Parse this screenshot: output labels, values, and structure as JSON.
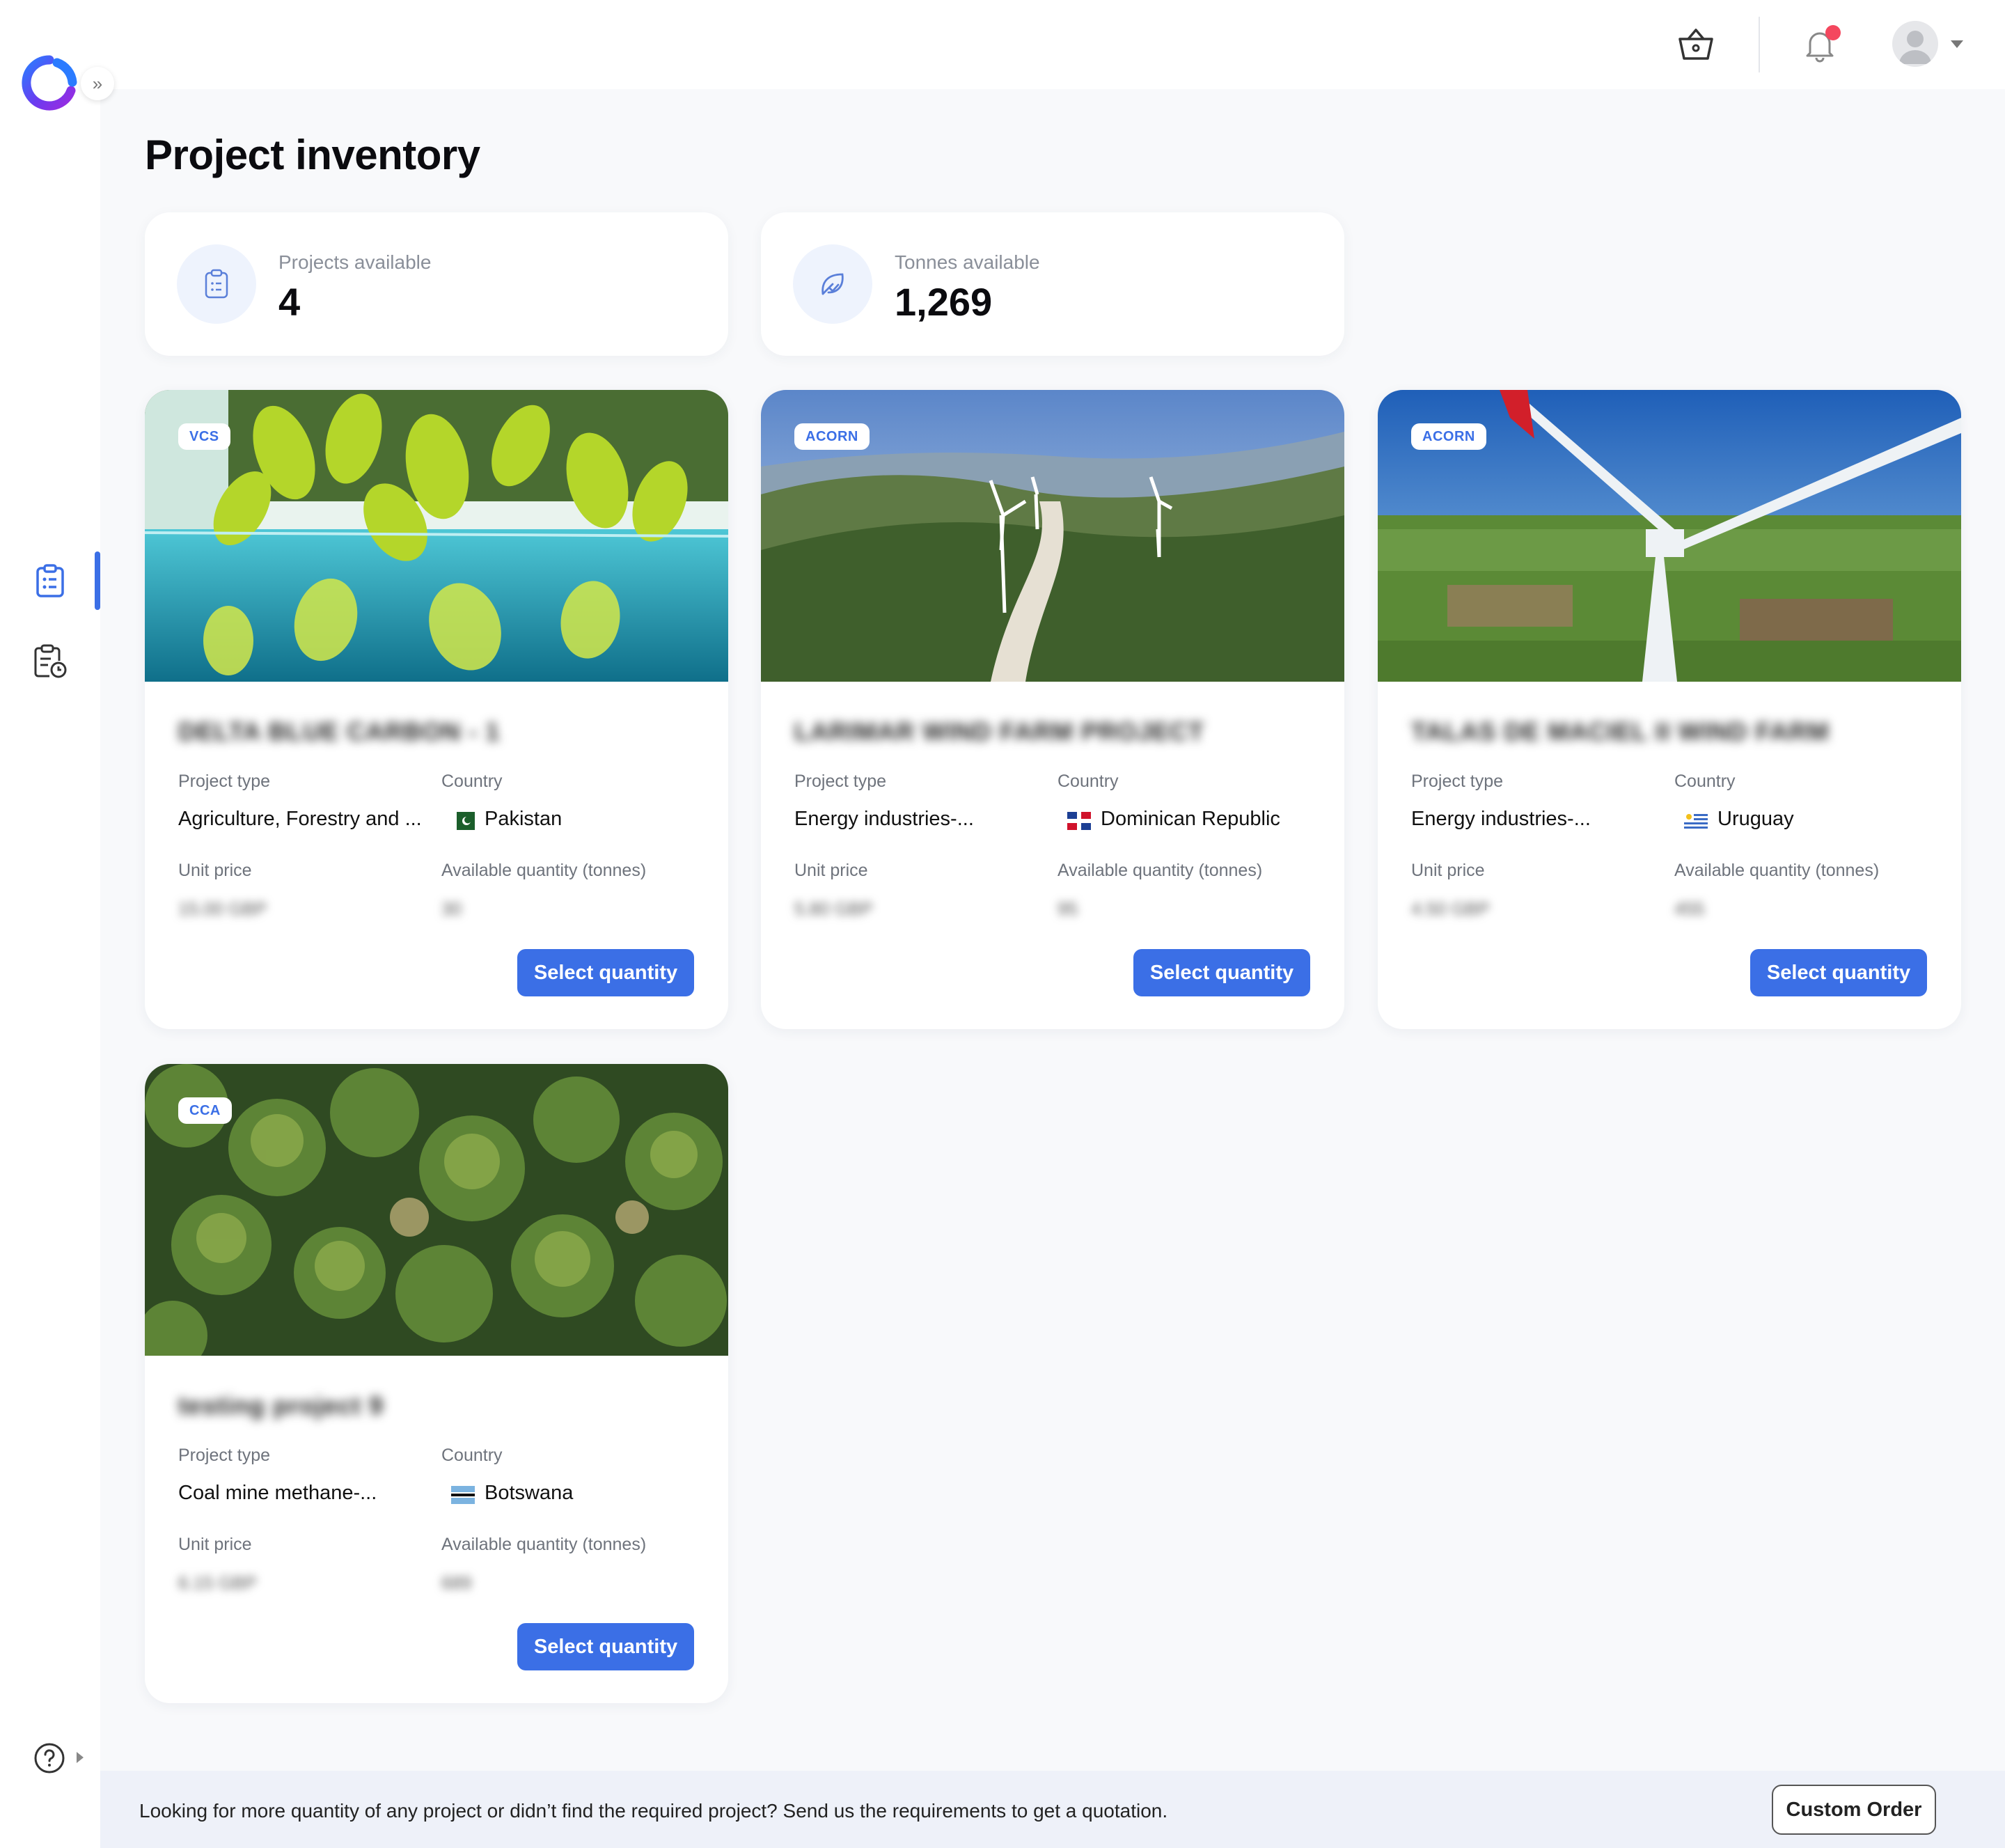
{
  "page": {
    "title": "Project inventory"
  },
  "stats": [
    {
      "label": "Projects available",
      "value": "4",
      "icon": "clipboard-icon"
    },
    {
      "label": "Tonnes available",
      "value": "1,269",
      "icon": "leaf-icon"
    }
  ],
  "cards": [
    {
      "badge": "VCS",
      "name": "DELTA BLUE CARBON - 1",
      "type_label": "Project type",
      "type_value": "Agriculture, Forestry and ...",
      "country_label": "Country",
      "country_value": "Pakistan",
      "price_label": "Unit price",
      "price_value": "15.00 GBP",
      "qty_label": "Available quantity (tonnes)",
      "qty_value": "30",
      "button": "Select quantity"
    },
    {
      "badge": "ACORN",
      "name": "LARIMAR WIND FARM PROJECT",
      "type_label": "Project type",
      "type_value": "Energy industries-...",
      "country_label": "Country",
      "country_value": "Dominican Republic",
      "price_label": "Unit price",
      "price_value": "5.80 GBP",
      "qty_label": "Available quantity (tonnes)",
      "qty_value": "95",
      "button": "Select quantity"
    },
    {
      "badge": "ACORN",
      "name": "TALAS DE MACIEL II WIND FARM",
      "type_label": "Project type",
      "type_value": "Energy industries-...",
      "country_label": "Country",
      "country_value": "Uruguay",
      "price_label": "Unit price",
      "price_value": "4.50 GBP",
      "qty_label": "Available quantity (tonnes)",
      "qty_value": "455",
      "button": "Select quantity"
    },
    {
      "badge": "CCA",
      "name": "testing project 9",
      "type_label": "Project type",
      "type_value": "Coal mine methane-...",
      "country_label": "Country",
      "country_value": "Botswana",
      "price_label": "Unit price",
      "price_value": "6.15 GBP",
      "qty_label": "Available quantity (tonnes)",
      "qty_value": "689",
      "button": "Select quantity"
    }
  ],
  "footer": {
    "text": "Looking for more quantity of any project or didn’t find the required project? Send us the requirements to get a quotation.",
    "button": "Custom Order"
  },
  "colors": {
    "accent": "#3b6fe6",
    "notification": "#f4475e"
  },
  "icons": [
    "logo-icon",
    "expand-icon",
    "inventory-icon",
    "orders-icon",
    "help-icon",
    "basket-icon",
    "bell-icon",
    "avatar-icon"
  ]
}
